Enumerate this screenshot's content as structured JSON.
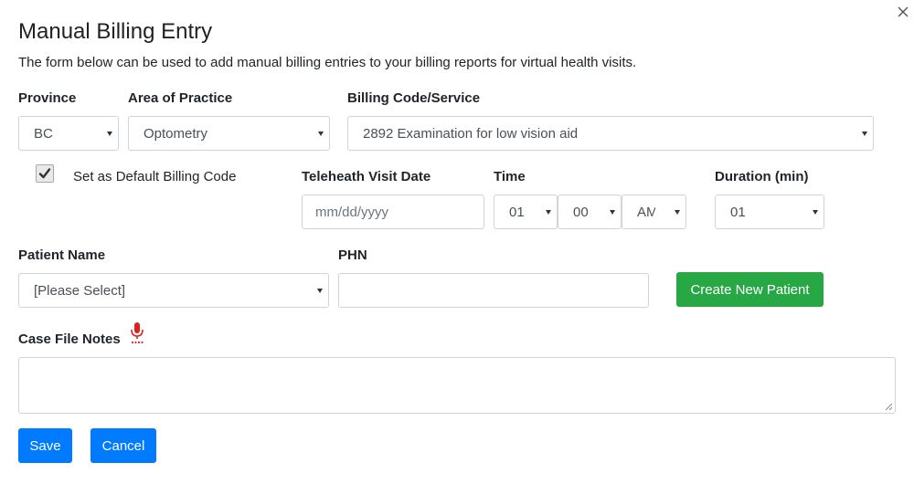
{
  "modal": {
    "title": "Manual Billing Entry",
    "subtitle": "The form below can be used to add manual billing entries to your billing reports for virtual health visits.",
    "close_icon": "close-icon"
  },
  "form": {
    "province": {
      "label": "Province",
      "value": "BC"
    },
    "area_of_practice": {
      "label": "Area of Practice",
      "value": "Optometry"
    },
    "billing_code": {
      "label": "Billing Code/Service",
      "value": "2892 Examination for low vision aid"
    },
    "default_billing": {
      "label": "Set as Default Billing Code",
      "checked": true
    },
    "visit_date": {
      "label": "Teleheath Visit Date",
      "placeholder": "mm/dd/yyyy"
    },
    "time": {
      "label": "Time",
      "hour": "01",
      "minute": "00",
      "ampm": "AM"
    },
    "duration": {
      "label": "Duration (min)",
      "value": "01"
    },
    "patient_name": {
      "label": "Patient Name",
      "value": "[Please Select]"
    },
    "phn": {
      "label": "PHN",
      "value": ""
    },
    "create_patient": {
      "label": "Create New Patient"
    },
    "case_notes": {
      "label": "Case File Notes",
      "mic_icon": "microphone-icon",
      "value": ""
    }
  },
  "actions": {
    "save": "Save",
    "cancel": "Cancel"
  },
  "colors": {
    "green": "#28a745",
    "blue": "#007bff",
    "mic_red": "#e02020"
  }
}
